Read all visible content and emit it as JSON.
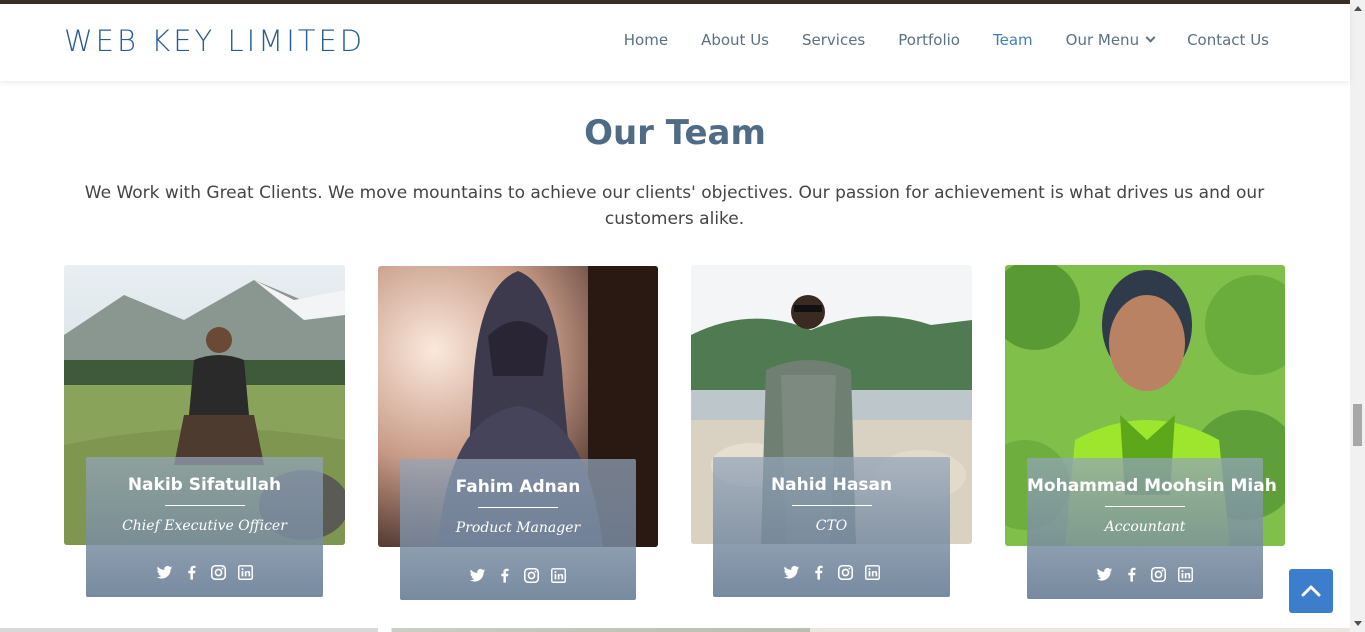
{
  "brand": "WEB KEY LIMITED",
  "nav": {
    "items": [
      {
        "label": "Home",
        "active": false
      },
      {
        "label": "About Us",
        "active": false
      },
      {
        "label": "Services",
        "active": false
      },
      {
        "label": "Portfolio",
        "active": false
      },
      {
        "label": "Team",
        "active": true
      },
      {
        "label": "Our Menu",
        "active": false,
        "dropdown": true
      },
      {
        "label": "Contact Us",
        "active": false
      }
    ]
  },
  "section": {
    "title": "Our Team",
    "description": "We Work with Great Clients. We move mountains to achieve our clients' objectives. Our passion for achievement is what drives us and our customers alike."
  },
  "team": [
    {
      "name": "Nakib Sifatullah",
      "role": "Chief Executive Officer"
    },
    {
      "name": "Fahim Adnan",
      "role": "Product Manager"
    },
    {
      "name": "Nahid Hasan",
      "role": "CTO"
    },
    {
      "name": "Mohammad Moohsin Miah",
      "role": "Accountant"
    }
  ],
  "social_icons": [
    "twitter-icon",
    "facebook-icon",
    "instagram-icon",
    "linkedin-icon"
  ],
  "colors": {
    "brand": "#2a5d8f",
    "nav_text": "#5a7184",
    "nav_active": "#3f7fbf",
    "title": "#4f6b85",
    "back_to_top": "#3d7ecc"
  }
}
